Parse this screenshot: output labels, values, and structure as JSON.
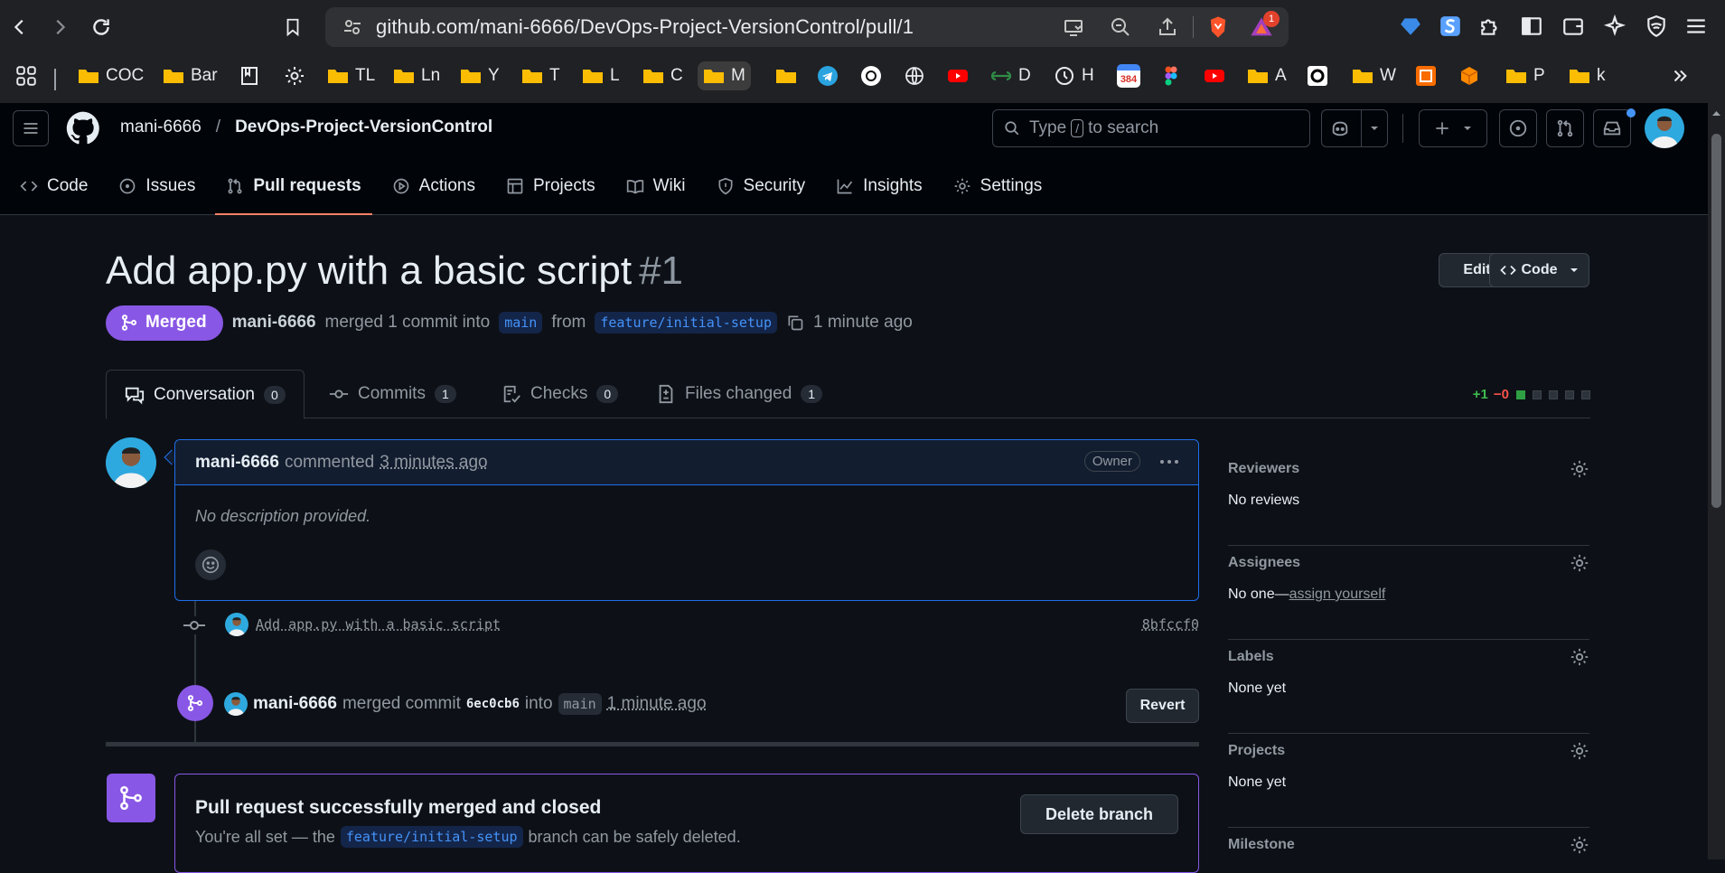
{
  "browser": {
    "url": "github.com/mani-6666/DevOps-Project-VersionControl/pull/1",
    "notification_count": "1",
    "bookmarks": [
      {
        "label": "COC",
        "kind": "folder"
      },
      {
        "label": "Bar",
        "kind": "folder"
      },
      {
        "label": "TL",
        "kind": "folder"
      },
      {
        "label": "Ln",
        "kind": "folder"
      },
      {
        "label": "Y",
        "kind": "folder"
      },
      {
        "label": "T",
        "kind": "folder"
      },
      {
        "label": "L",
        "kind": "folder"
      },
      {
        "label": "C",
        "kind": "folder"
      },
      {
        "label": "M",
        "kind": "folder"
      },
      {
        "label": "D",
        "kind": "site"
      },
      {
        "label": "H",
        "kind": "site"
      },
      {
        "label": "384",
        "kind": "badge"
      },
      {
        "label": "A",
        "kind": "folder"
      },
      {
        "label": "W",
        "kind": "folder"
      },
      {
        "label": "P",
        "kind": "folder"
      },
      {
        "label": "k",
        "kind": "folder"
      }
    ]
  },
  "header": {
    "owner": "mani-6666",
    "separator": "/",
    "repo": "DevOps-Project-VersionControl",
    "search_prefix": "Type",
    "search_key": "/",
    "search_suffix": "to search"
  },
  "repo_tabs": [
    {
      "label": "Code",
      "icon": "code-icon"
    },
    {
      "label": "Issues",
      "icon": "issue-icon"
    },
    {
      "label": "Pull requests",
      "icon": "pull-request-icon",
      "active": true
    },
    {
      "label": "Actions",
      "icon": "play-icon"
    },
    {
      "label": "Projects",
      "icon": "table-icon"
    },
    {
      "label": "Wiki",
      "icon": "book-icon"
    },
    {
      "label": "Security",
      "icon": "shield-icon"
    },
    {
      "label": "Insights",
      "icon": "graph-icon"
    },
    {
      "label": "Settings",
      "icon": "gear-icon"
    }
  ],
  "pr": {
    "title": "Add app.py with a basic script",
    "number": "#1",
    "edit_label": "Edit",
    "code_label": "Code",
    "state": "Merged",
    "author": "mani-6666",
    "merged_text": "merged 1 commit into",
    "base_branch": "main",
    "from_text": "from",
    "head_branch": "feature/initial-setup",
    "time": "1 minute ago"
  },
  "pr_tabs": [
    {
      "label": "Conversation",
      "count": "0",
      "icon": "comment-icon"
    },
    {
      "label": "Commits",
      "count": "1",
      "icon": "commit-icon"
    },
    {
      "label": "Checks",
      "count": "0",
      "icon": "checklist-icon"
    },
    {
      "label": "Files changed",
      "count": "1",
      "icon": "file-diff-icon"
    }
  ],
  "diffstat": {
    "added": "+1",
    "removed": "−0"
  },
  "comment": {
    "author": "mani-6666",
    "action": "commented",
    "time": "3 minutes ago",
    "role": "Owner",
    "body": "No description provided."
  },
  "commit": {
    "message": "Add app.py with a basic script",
    "sha": "8bfccf0"
  },
  "merge_event": {
    "author": "mani-6666",
    "text": "merged commit",
    "sha": "6ec0cb6",
    "into": "into",
    "branch": "main",
    "time": "1 minute ago",
    "revert_label": "Revert"
  },
  "merged_box": {
    "title": "Pull request successfully merged and closed",
    "sub_prefix": "You're all set — the",
    "branch": "feature/initial-setup",
    "sub_suffix": "branch can be safely deleted.",
    "button": "Delete branch"
  },
  "sidebar": {
    "reviewers": {
      "title": "Reviewers",
      "value": "No reviews"
    },
    "assignees": {
      "title": "Assignees",
      "value": "No one—",
      "link": "assign yourself"
    },
    "labels": {
      "title": "Labels",
      "value": "None yet"
    },
    "projects": {
      "title": "Projects",
      "value": "None yet"
    },
    "milestone": {
      "title": "Milestone"
    }
  },
  "colors": {
    "accent_merged": "#8957e5",
    "tab_underline": "#f78166",
    "link_blue": "#4493f8",
    "diff_green": "#3fb950",
    "diff_red": "#f85149"
  }
}
